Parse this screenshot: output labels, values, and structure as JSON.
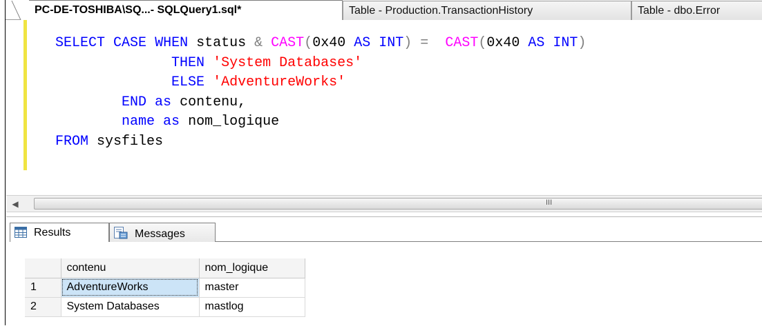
{
  "tabs": [
    {
      "label": "PC-DE-TOSHIBA\\SQ...- SQLQuery1.sql*",
      "active": true
    },
    {
      "label": "Table - Production.TransactionHistory",
      "active": false
    },
    {
      "label": "Table - dbo.Error",
      "active": false
    }
  ],
  "editor": {
    "tokens": {
      "select": "SELECT",
      "case": "CASE",
      "when": "WHEN",
      "status": "status",
      "amp": "&",
      "cast1": "CAST",
      "open1": "(",
      "hex1": "0x40",
      "as1": "AS",
      "int1": "INT",
      "close1": ")",
      "eq": "=",
      "cast2": "CAST",
      "open2": "(",
      "hex2": "0x40",
      "as2": "AS",
      "int2": "INT",
      "close2": ")",
      "then": "THEN",
      "str1": "'System Databases'",
      "else": "ELSE",
      "str2": "'AdventureWorks'",
      "end": "END",
      "as3": "as",
      "contenu": "contenu,",
      "name": "name",
      "as4": "as",
      "nom_logique": "nom_logique",
      "from": "FROM",
      "sysfiles": "sysfiles"
    }
  },
  "scrollbar": {
    "grip": "III"
  },
  "result_tabs": {
    "results": "Results",
    "messages": "Messages"
  },
  "grid": {
    "columns": [
      "contenu",
      "nom_logique"
    ],
    "rows": [
      {
        "num": "1",
        "contenu": "AdventureWorks",
        "nom_logique": "master"
      },
      {
        "num": "2",
        "contenu": "System Databases",
        "nom_logique": "mastlog"
      }
    ]
  },
  "colors": {
    "keyword": "#0000ff",
    "function": "#ff00ff",
    "string": "#ff0000",
    "operator": "#808080",
    "change_bar": "#f0e442",
    "selected_cell": "#cce4f7"
  }
}
